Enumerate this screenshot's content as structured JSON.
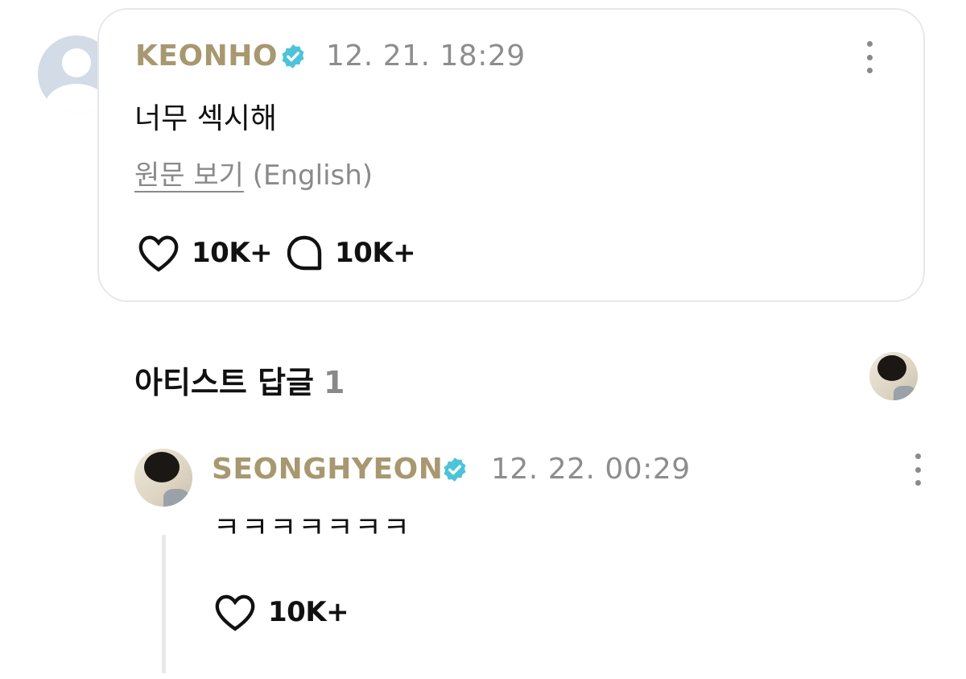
{
  "comment": {
    "username": "KEONHO",
    "timestamp": "12. 21. 18:29",
    "text": "너무 섹시해",
    "original_link": "원문 보기",
    "original_lang": "(English)",
    "likes": "10K+",
    "replies": "10K+"
  },
  "artist_section": {
    "title": "아티스트 답글",
    "count": "1"
  },
  "reply": {
    "username": "SEONGHYEON",
    "timestamp": "12. 22. 00:29",
    "text": "ㅋㅋㅋㅋㅋㅋㅋ",
    "likes": "10K+"
  },
  "colors": {
    "username": "#a89870",
    "verified_badge": "#4cc3d9",
    "timestamp": "#8d8d8d",
    "card_border": "#e7e8ec",
    "default_avatar": "#d3dbe6"
  },
  "icons": {
    "verified": "verified-badge-icon",
    "more": "more-vertical-icon",
    "like": "heart-icon",
    "reply": "speech-bubble-icon"
  }
}
